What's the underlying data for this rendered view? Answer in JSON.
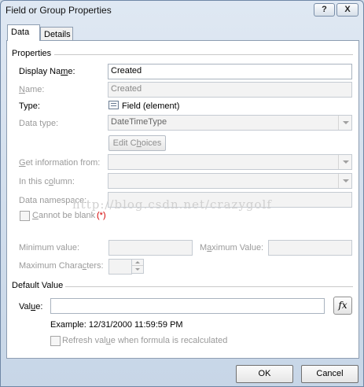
{
  "window": {
    "title": "Field or Group Properties",
    "help_label": "?",
    "close_label": "X"
  },
  "tabs": [
    {
      "label": "Data"
    },
    {
      "label": "Details"
    }
  ],
  "properties": {
    "group_label": "Properties",
    "display_name": {
      "label_pre": "Display Na",
      "label_key": "m",
      "label_post": "e:",
      "value": "Created"
    },
    "name": {
      "label_pre": "",
      "label_key": "N",
      "label_post": "ame:",
      "value": "Created"
    },
    "type": {
      "label": "Type:",
      "value": "Field (element)",
      "icon": "field-element-icon"
    },
    "data_type": {
      "label": "Data type:",
      "value": "DateTimeType"
    },
    "edit_choices": {
      "pre": "Edit C",
      "key": "h",
      "post": "oices"
    },
    "get_info_from": {
      "label_pre": "",
      "label_key": "G",
      "label_post": "et information from:",
      "value": ""
    },
    "in_this_column": {
      "label_pre": "In this c",
      "label_key": "o",
      "label_post": "lumn:",
      "value": ""
    },
    "data_namespace": {
      "label": "Data namespace:",
      "value": ""
    },
    "cannot_be_blank": {
      "label_pre": "",
      "label_key": "C",
      "label_post": "annot be blank",
      "required_mark": "(*)",
      "checked": false
    },
    "minimum_value": {
      "label": "Minimum value:",
      "value": ""
    },
    "maximum_value": {
      "label_pre": "M",
      "label_key": "a",
      "label_post": "ximum Value:",
      "value": ""
    },
    "maximum_characters": {
      "label_pre": "Maximum Chara",
      "label_key": "c",
      "label_post": "ters:",
      "value": ""
    }
  },
  "default_value": {
    "group_label": "Default Value",
    "value": {
      "label_pre": "Val",
      "label_key": "u",
      "label_post": "e:",
      "value": ""
    },
    "formula_button": "fx",
    "example": "Example: 12/31/2000 11:59:59 PM",
    "refresh": {
      "label_pre": "Refresh val",
      "label_key": "u",
      "label_post": "e when formula is recalculated",
      "checked": false
    }
  },
  "watermark": "http://blog.csdn.net/crazygolf",
  "buttons": {
    "ok": "OK",
    "cancel": "Cancel"
  },
  "colors": {
    "title_bg": "#cfdbe8",
    "panel_bg": "#ffffff",
    "required": "#d40000"
  }
}
